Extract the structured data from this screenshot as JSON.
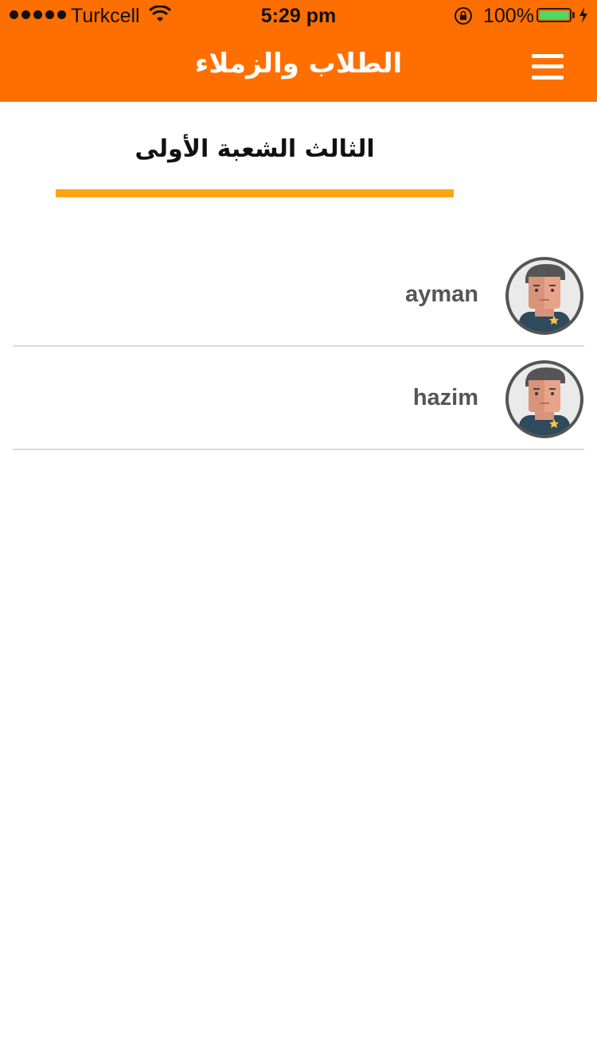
{
  "status_bar": {
    "carrier": "Turkcell",
    "time": "5:29 pm",
    "battery": "100%"
  },
  "header": {
    "title": "الطلاب والزملاء",
    "menu_icon": "hamburger-menu-icon",
    "background": "#ff6f00"
  },
  "section": {
    "title": "الثالث الشعبة الأولى",
    "underline_color": "#ffa412"
  },
  "students": [
    {
      "name": "ayman",
      "avatar": "student-avatar-icon"
    },
    {
      "name": "hazim",
      "avatar": "student-avatar-icon"
    }
  ]
}
